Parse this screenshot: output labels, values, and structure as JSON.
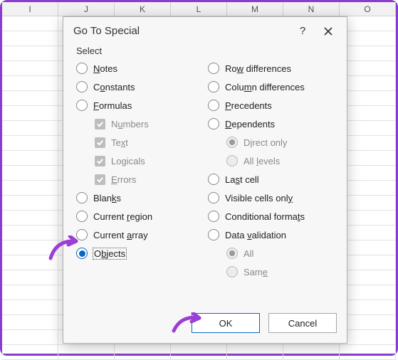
{
  "columns": [
    "I",
    "J",
    "K",
    "L",
    "M",
    "N",
    "O"
  ],
  "dialog": {
    "title": "Go To Special",
    "help_icon": "?",
    "section": "Select",
    "left": [
      {
        "key": "notes",
        "pre": "",
        "u": "N",
        "post": "otes",
        "type": "radio"
      },
      {
        "key": "constants",
        "pre": "C",
        "u": "o",
        "post": "nstants",
        "type": "radio"
      },
      {
        "key": "formulas",
        "pre": "",
        "u": "F",
        "post": "ormulas",
        "type": "radio"
      },
      {
        "key": "numbers",
        "pre": "N",
        "u": "u",
        "post": "mbers",
        "type": "check",
        "sub": true,
        "disabled": true
      },
      {
        "key": "text",
        "pre": "Te",
        "u": "x",
        "post": "t",
        "type": "check",
        "sub": true,
        "disabled": true
      },
      {
        "key": "logicals",
        "pre": "Lo",
        "u": "g",
        "post": "icals",
        "type": "check",
        "sub": true,
        "disabled": true
      },
      {
        "key": "errors",
        "pre": "",
        "u": "E",
        "post": "rrors",
        "type": "check",
        "sub": true,
        "disabled": true
      },
      {
        "key": "blanks",
        "pre": "Blan",
        "u": "k",
        "post": "s",
        "type": "radio"
      },
      {
        "key": "current-region",
        "pre": "Current ",
        "u": "r",
        "post": "egion",
        "type": "radio"
      },
      {
        "key": "current-array",
        "pre": "Current ",
        "u": "a",
        "post": "rray",
        "type": "radio"
      },
      {
        "key": "objects",
        "pre": "O",
        "u": "b",
        "post": "jects",
        "type": "radio",
        "selected": true,
        "focus": true
      }
    ],
    "right": [
      {
        "key": "row-differences",
        "pre": "Ro",
        "u": "w",
        "post": " differences",
        "type": "radio"
      },
      {
        "key": "column-differences",
        "pre": "Colu",
        "u": "m",
        "post": "n differences",
        "type": "radio"
      },
      {
        "key": "precedents",
        "pre": "",
        "u": "P",
        "post": "recedents",
        "type": "radio"
      },
      {
        "key": "dependents",
        "pre": "",
        "u": "D",
        "post": "ependents",
        "type": "radio"
      },
      {
        "key": "direct-only",
        "pre": "D",
        "u": "i",
        "post": "rect only",
        "type": "radio-dis-dot",
        "sub": true,
        "disabled": true
      },
      {
        "key": "all-levels",
        "pre": "All ",
        "u": "l",
        "post": "evels",
        "type": "radio-dis",
        "sub": true,
        "disabled": true
      },
      {
        "key": "last-cell",
        "pre": "La",
        "u": "s",
        "post": "t cell",
        "type": "radio"
      },
      {
        "key": "visible-cells",
        "pre": "Visible cells onl",
        "u": "y",
        "post": "",
        "type": "radio"
      },
      {
        "key": "conditional-formats",
        "pre": "Conditional forma",
        "u": "t",
        "post": "s",
        "type": "radio"
      },
      {
        "key": "data-validation",
        "pre": "Data ",
        "u": "v",
        "post": "alidation",
        "type": "radio"
      },
      {
        "key": "all",
        "pre": "All",
        "u": "",
        "post": "",
        "type": "radio-dis-dot",
        "sub": true,
        "disabled": true
      },
      {
        "key": "same",
        "pre": "Sam",
        "u": "e",
        "post": "",
        "type": "radio-dis",
        "sub": true,
        "disabled": true
      }
    ],
    "ok": "OK",
    "cancel": "Cancel"
  }
}
